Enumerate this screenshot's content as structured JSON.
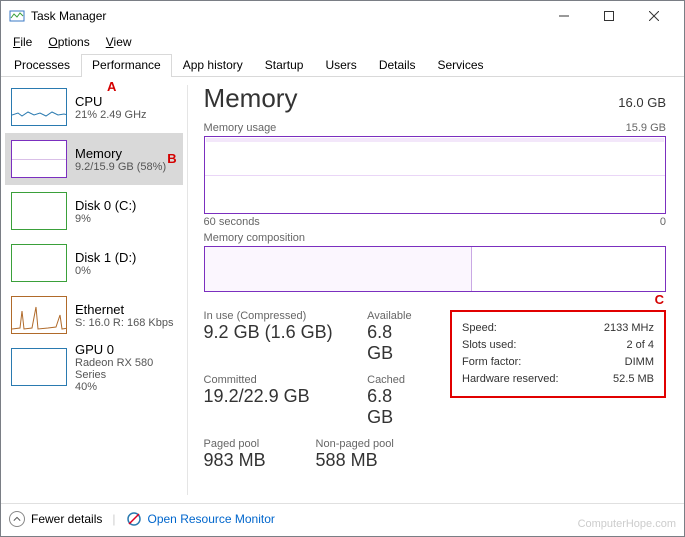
{
  "window": {
    "title": "Task Manager"
  },
  "menubar": [
    "File",
    "Options",
    "View"
  ],
  "tabs": [
    "Processes",
    "Performance",
    "App history",
    "Startup",
    "Users",
    "Details",
    "Services"
  ],
  "active_tab": "Performance",
  "annotations": {
    "A": "A",
    "B": "B",
    "C": "C"
  },
  "sidebar": [
    {
      "title": "CPU",
      "subtitle": "21%  2.49 GHz",
      "color": "#2a7ab0"
    },
    {
      "title": "Memory",
      "subtitle": "9.2/15.9 GB (58%)",
      "color": "#7b2fbf",
      "selected": true
    },
    {
      "title": "Disk 0 (C:)",
      "subtitle": "9%",
      "color": "#3aa03a"
    },
    {
      "title": "Disk 1 (D:)",
      "subtitle": "0%",
      "color": "#3aa03a"
    },
    {
      "title": "Ethernet",
      "subtitle": "S: 16.0  R: 168 Kbps",
      "color": "#b06a2a"
    },
    {
      "title": "GPU 0",
      "subtitle": "Radeon RX 580 Series\n40%",
      "color": "#2a7ab0"
    }
  ],
  "main": {
    "heading": "Memory",
    "total": "16.0 GB",
    "usage_label": "Memory usage",
    "usage_right": "15.9 GB",
    "axis_left": "60 seconds",
    "axis_right": "0",
    "composition_label": "Memory composition",
    "stats": {
      "in_use_label": "In use (Compressed)",
      "in_use": "9.2 GB (1.6 GB)",
      "available_label": "Available",
      "available": "6.8 GB",
      "committed_label": "Committed",
      "committed": "19.2/22.9 GB",
      "cached_label": "Cached",
      "cached": "6.8 GB",
      "paged_label": "Paged pool",
      "paged": "983 MB",
      "nonpaged_label": "Non-paged pool",
      "nonpaged": "588 MB"
    },
    "details": {
      "speed_label": "Speed:",
      "speed": "2133 MHz",
      "slots_label": "Slots used:",
      "slots": "2 of 4",
      "form_label": "Form factor:",
      "form": "DIMM",
      "reserved_label": "Hardware reserved:",
      "reserved": "52.5 MB"
    }
  },
  "footer": {
    "fewer": "Fewer details",
    "monitor": "Open Resource Monitor"
  },
  "watermark": "ComputerHope.com",
  "chart_data": {
    "type": "area",
    "title": "Memory usage",
    "xlabel": "60 seconds → 0",
    "ylabel": "GB",
    "ylim": [
      0,
      15.9
    ],
    "series": [
      {
        "name": "In use",
        "approx_constant_value": 9.2
      }
    ],
    "composition": {
      "type": "bar",
      "segments": [
        {
          "name": "In use",
          "value": 9.2
        },
        {
          "name": "Available",
          "value": 6.8
        }
      ],
      "total": 16.0
    }
  }
}
